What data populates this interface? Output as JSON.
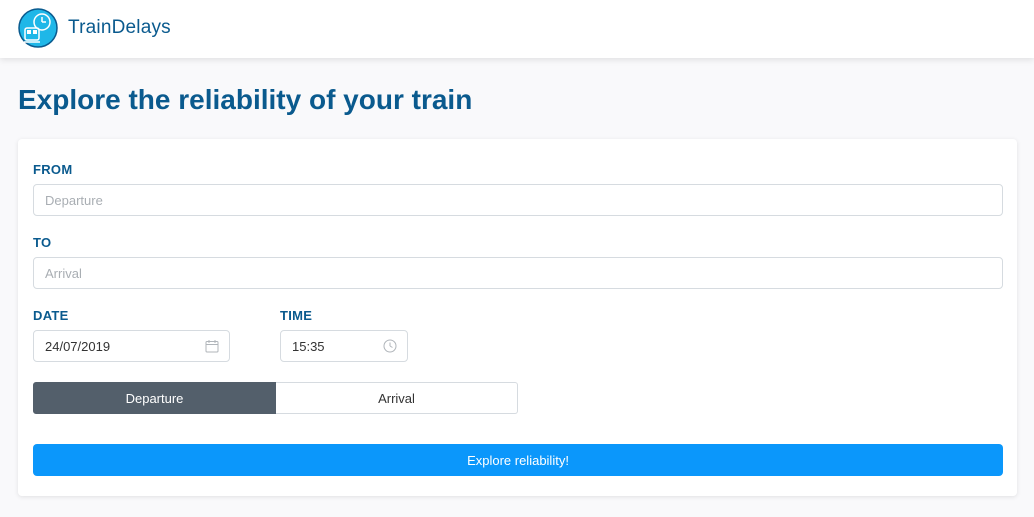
{
  "app": {
    "name": "TrainDelays",
    "logo_icon": "train-clock-logo-icon"
  },
  "page": {
    "title": "Explore the reliability of your train"
  },
  "form": {
    "from": {
      "label": "FROM",
      "placeholder": "Departure",
      "value": ""
    },
    "to": {
      "label": "TO",
      "placeholder": "Arrival",
      "value": ""
    },
    "date": {
      "label": "DATE",
      "value": "24/07/2019",
      "icon": "calendar-icon"
    },
    "time": {
      "label": "TIME",
      "value": "15:35",
      "icon": "clock-icon"
    },
    "mode_toggle": {
      "options": [
        "Departure",
        "Arrival"
      ],
      "selected": "Departure"
    },
    "submit_label": "Explore reliability!"
  },
  "colors": {
    "brand": "#0a5a8e",
    "primary_button": "#0b97fb",
    "toggle_active": "#535f6b"
  }
}
